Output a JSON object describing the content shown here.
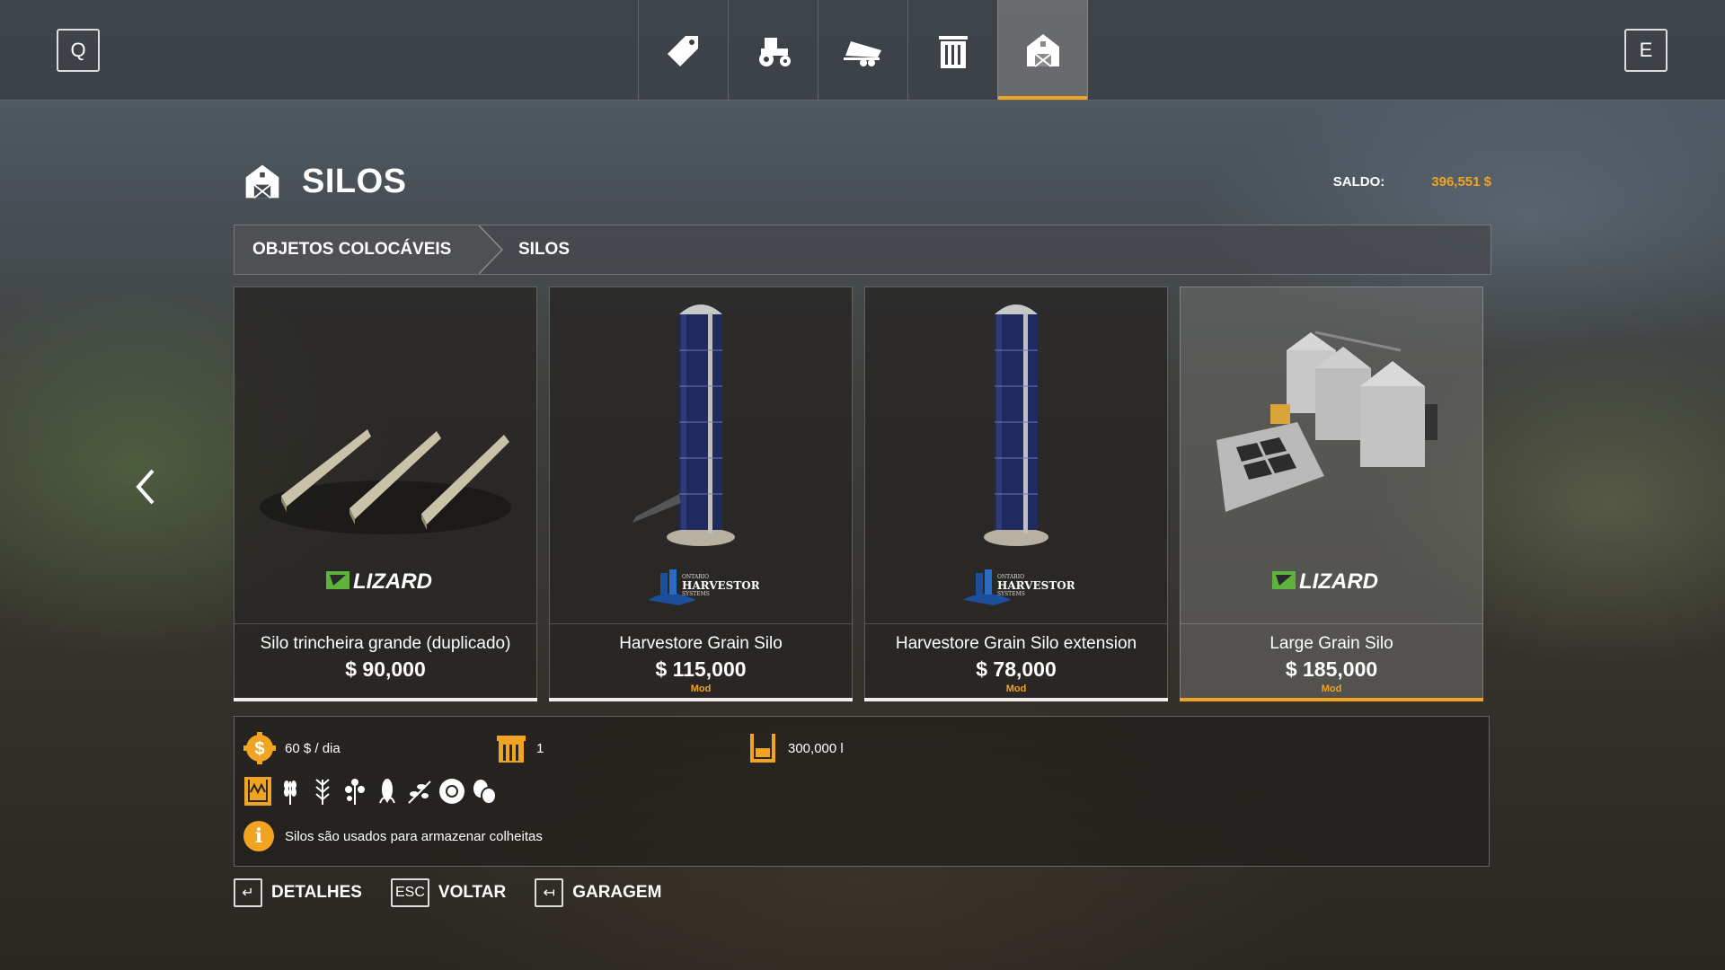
{
  "topbar": {
    "left_key": "Q",
    "right_key": "E",
    "tabs": [
      {
        "icon": "price-tag-icon",
        "active": false
      },
      {
        "icon": "tractor-icon",
        "active": false
      },
      {
        "icon": "trailer-icon",
        "active": false
      },
      {
        "icon": "storage-building-icon",
        "active": false
      },
      {
        "icon": "barn-icon",
        "active": true
      }
    ]
  },
  "page": {
    "title": "SILOS",
    "title_icon": "barn-icon",
    "balance_label": "SALDO:",
    "balance_value": "396,551 $"
  },
  "breadcrumb": [
    "OBJETOS COLOCÁVEIS",
    "SILOS"
  ],
  "items": [
    {
      "name": "Silo trincheira grande (duplicado)",
      "price": "$ 90,000",
      "mod": "",
      "brand": "LIZARD",
      "selected": false
    },
    {
      "name": "Harvestore Grain Silo",
      "price": "$ 115,000",
      "mod": "Mod",
      "brand": "HARVESTORE",
      "selected": false
    },
    {
      "name": "Harvestore Grain Silo extension",
      "price": "$ 78,000",
      "mod": "Mod",
      "brand": "HARVESTORE",
      "selected": false
    },
    {
      "name": "Large Grain Silo",
      "price": "$ 185,000",
      "mod": "Mod",
      "brand": "LIZARD",
      "selected": true
    }
  ],
  "details": {
    "upkeep": "60 $ / dia",
    "count": "1",
    "capacity": "300,000 l",
    "fill_types": [
      "silo-fill-icon",
      "wheat-icon",
      "barley-icon",
      "canola-icon",
      "corn-icon",
      "soybean-icon",
      "sunflower-icon",
      "potato-icon"
    ],
    "description": "Silos são usados para armazenar colheitas"
  },
  "actions": [
    {
      "key": "↵",
      "label": "DETALHES"
    },
    {
      "key": "ESC",
      "label": "VOLTAR"
    },
    {
      "key": "↤",
      "label": "GARAGEM"
    }
  ],
  "colors": {
    "accent": "#f0a422"
  }
}
